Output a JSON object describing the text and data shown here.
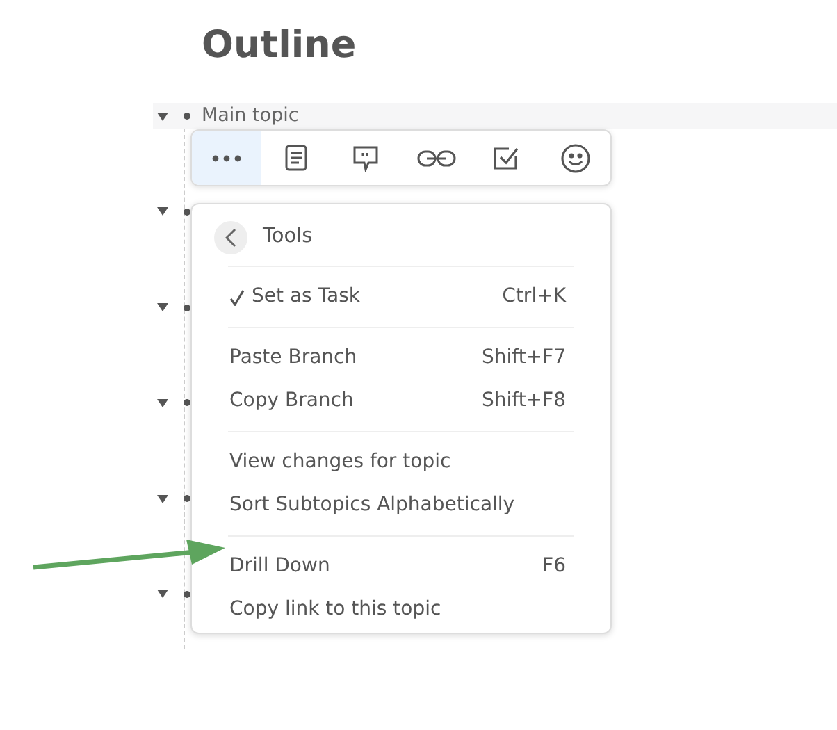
{
  "page_title": "Outline",
  "outline": [
    {
      "text": "Main topic",
      "expanded": true
    },
    {
      "expanded": true
    },
    {
      "expanded": true
    },
    {
      "expanded": true
    },
    {
      "expanded": true
    },
    {
      "expanded": true
    }
  ],
  "toolbar": [
    {
      "selected": true
    },
    {
      "selected": false
    },
    {
      "selected": false
    },
    {
      "selected": false
    },
    {
      "selected": false
    },
    {
      "selected": false
    }
  ],
  "menu": {
    "title": "Tools",
    "groups": [
      [
        {
          "label": "Set as Task",
          "shortcut": "Ctrl+K",
          "checked": true
        }
      ],
      [
        {
          "label": "Paste Branch",
          "shortcut": "Shift+F7",
          "checked": false
        },
        {
          "label": "Copy Branch",
          "shortcut": "Shift+F8",
          "checked": false
        }
      ],
      [
        {
          "label": "View changes for topic",
          "checked": false
        },
        {
          "label": "Sort Subtopics Alphabetically",
          "checked": false
        }
      ],
      [
        {
          "label": "Drill Down",
          "shortcut": "F6",
          "checked": false
        },
        {
          "label": "Copy link to this topic",
          "checked": false
        }
      ]
    ]
  }
}
